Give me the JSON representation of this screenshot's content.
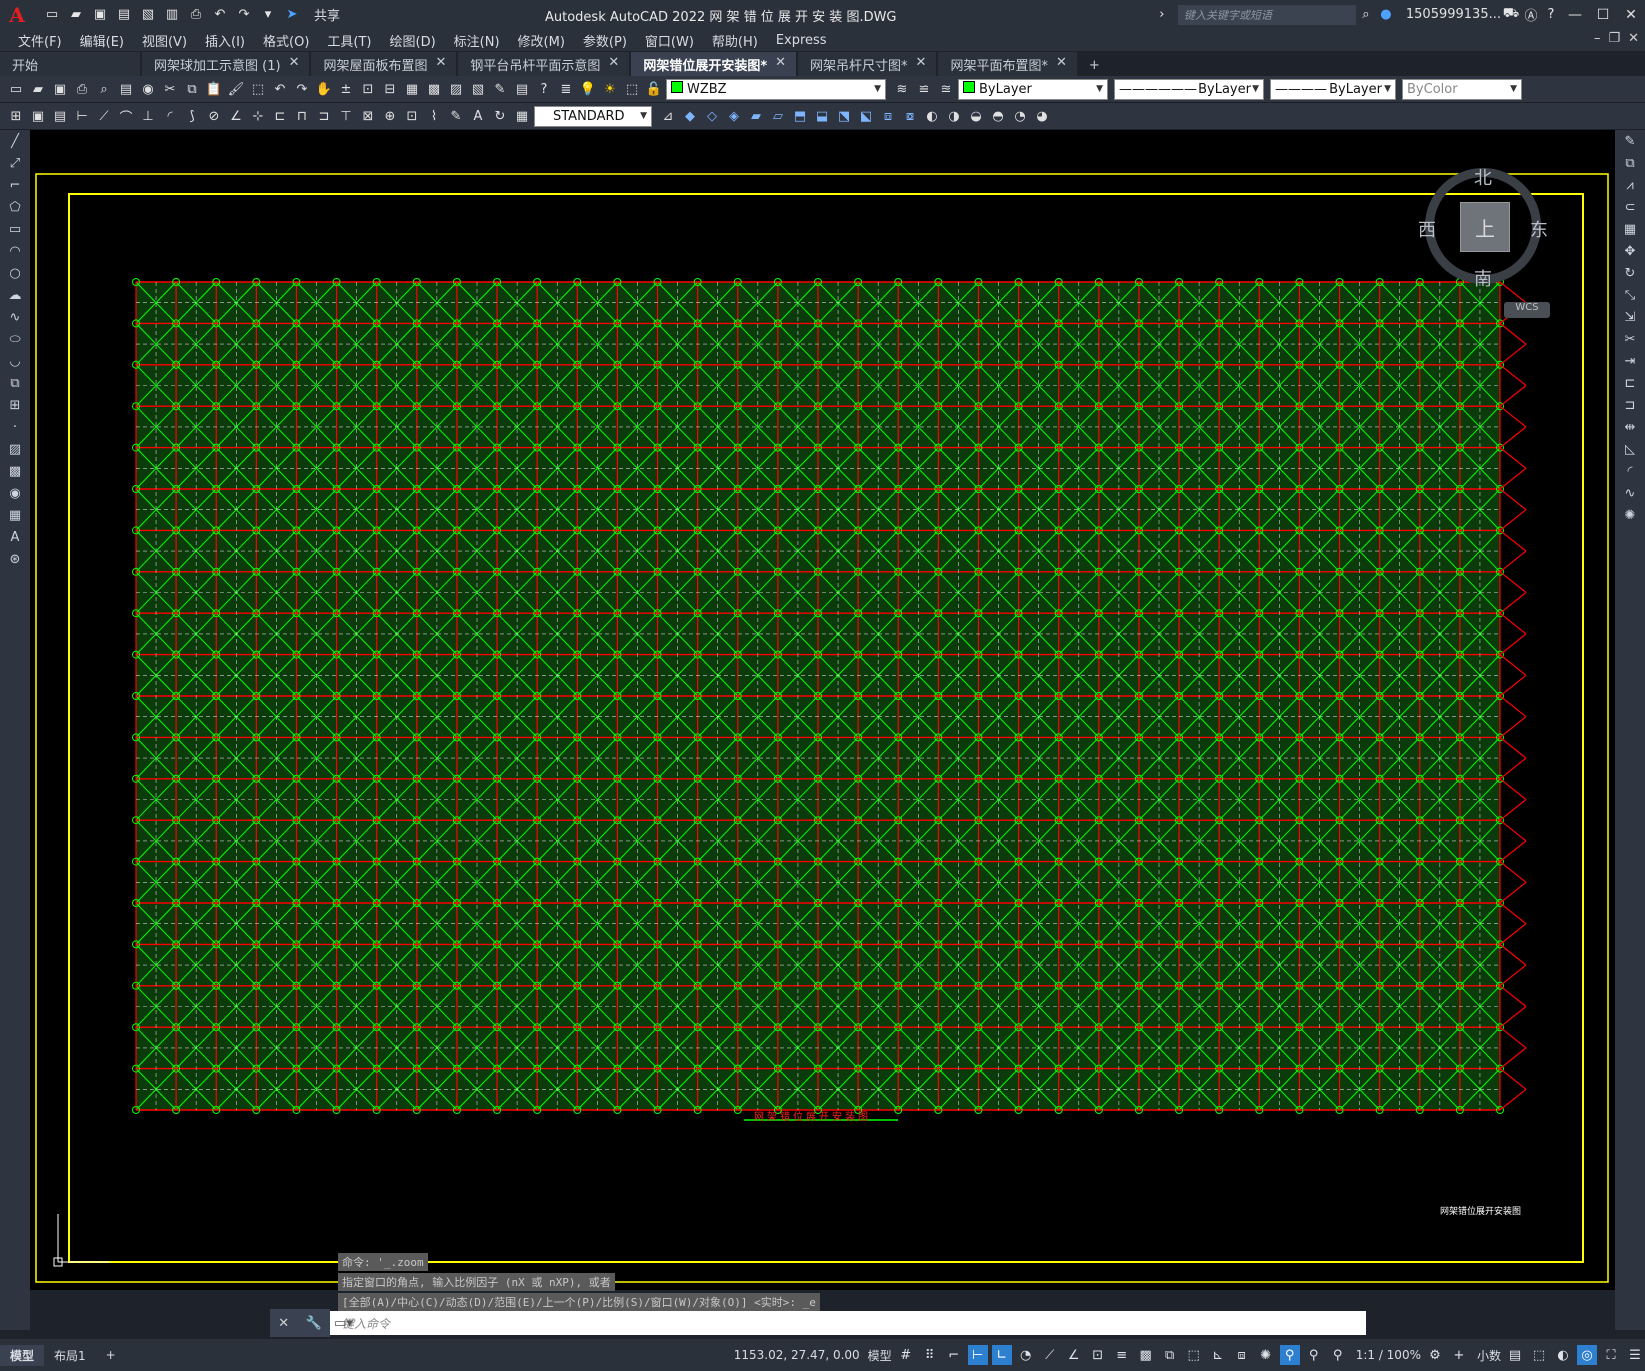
{
  "titlebar": {
    "app_icon": "A",
    "window_title": "Autodesk AutoCAD 2022    网 架 错 位 展 开 安 装 图.DWG",
    "share_label": "共享",
    "search_placeholder": "键入关键字或短语",
    "user_name": "1505999135...",
    "qat_icons": [
      "new-icon",
      "open-icon",
      "save-icon",
      "saveas-icon",
      "publish-icon",
      "plot-icon",
      "print-icon",
      "undo-icon",
      "redo-icon",
      "share-icon"
    ]
  },
  "menubar": {
    "items": [
      "文件(F)",
      "编辑(E)",
      "视图(V)",
      "插入(I)",
      "格式(O)",
      "工具(T)",
      "绘图(D)",
      "标注(N)",
      "修改(M)",
      "参数(P)",
      "窗口(W)",
      "帮助(H)",
      "Express"
    ]
  },
  "tabs": [
    {
      "label": "开始",
      "closable": false,
      "active": false
    },
    {
      "label": "网架球加工示意图 (1)",
      "closable": true,
      "active": false
    },
    {
      "label": "网架屋面板布置图",
      "closable": true,
      "active": false
    },
    {
      "label": "钢平台吊杆平面示意图",
      "closable": true,
      "active": false
    },
    {
      "label": "网架错位展开安装图*",
      "closable": true,
      "active": true
    },
    {
      "label": "网架吊杆尺寸图*",
      "closable": true,
      "active": false
    },
    {
      "label": "网架平面布置图*",
      "closable": true,
      "active": false
    }
  ],
  "toolbar_row1": {
    "layer": "WZBZ",
    "color": "ByLayer",
    "linetype": "ByLayer",
    "lineweight": "ByLayer",
    "plotstyle": "ByColor",
    "layer_color": "#00ff00"
  },
  "toolbar_row2": {
    "text_style": "STANDARD"
  },
  "viewcube": {
    "north": "北",
    "south": "南",
    "east": "东",
    "west": "西",
    "face": "上",
    "wcs": "WCS"
  },
  "drawing": {
    "title_text": "网架错位展开安装图",
    "titleblock_text": "网架错位展开安装图",
    "grid_cols": 34,
    "grid_rows": 20,
    "line_color": "#00ff00",
    "frame_color": "#ffff00",
    "member_color": "#ff0000"
  },
  "command": {
    "history": [
      "命令: '_.zoom",
      "指定窗口的角点, 输入比例因子 (nX 或 nXP), 或者",
      "[全部(A)/中心(C)/动态(D)/范围(E)/上一个(P)/比例(S)/窗口(W)/对象(O)] <实时>: _e"
    ],
    "input_placeholder": "键入命令"
  },
  "statusbar": {
    "layout_tabs": [
      "模型",
      "布局1"
    ],
    "coords": "1153.02, 27.47, 0.00",
    "space": "模型",
    "scale": "1:1 / 100%",
    "units": "小数"
  }
}
